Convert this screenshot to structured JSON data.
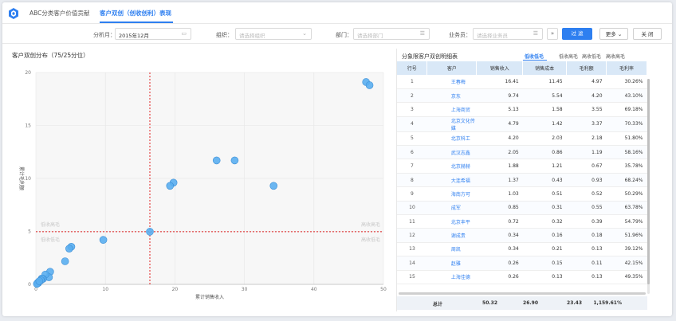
{
  "header": {
    "tabs": [
      {
        "label": "ABC分类客户价值贡献"
      },
      {
        "label": "客户双创（创收创利）表现"
      }
    ]
  },
  "filters": {
    "period_label": "分析月：",
    "period_value": "2015年12月",
    "org_label": "组织：",
    "org_placeholder": "请选择组织",
    "dept_label": "部门：",
    "dept_placeholder": "请选择部门",
    "sales_label": "业务员：",
    "sales_placeholder": "请选择业务员",
    "filter_button": "过 滤",
    "more_button": "更多",
    "close_button": "关 闭"
  },
  "left_panel": {
    "title": "客户双创分布（75/25分位）"
  },
  "chart_data": {
    "type": "scatter",
    "xlabel": "累计销售收入",
    "ylabel": "累计毛利额",
    "xlim": [
      0,
      50
    ],
    "ylim": [
      0,
      20
    ],
    "xticks": [
      0,
      10,
      20,
      30,
      40,
      50
    ],
    "yticks": [
      0,
      5,
      10,
      15,
      20
    ],
    "ref_x": 16.4,
    "ref_y": 4.97,
    "grid": true,
    "quadrant_labels": {
      "top_left": "低收高毛",
      "top_right": "高收高毛",
      "bottom_left": "低收低毛",
      "bottom_right": "高收低毛"
    },
    "point_color": "#5aaef0",
    "ref_line_color": "#e02020",
    "points": [
      {
        "x": 47.5,
        "y": 19.1
      },
      {
        "x": 48.0,
        "y": 18.8
      },
      {
        "x": 26.0,
        "y": 11.7
      },
      {
        "x": 28.6,
        "y": 11.7
      },
      {
        "x": 19.8,
        "y": 9.6
      },
      {
        "x": 19.3,
        "y": 9.3
      },
      {
        "x": 34.2,
        "y": 9.3
      },
      {
        "x": 16.4,
        "y": 4.97
      },
      {
        "x": 9.7,
        "y": 4.2
      },
      {
        "x": 5.1,
        "y": 3.55
      },
      {
        "x": 4.8,
        "y": 3.37
      },
      {
        "x": 4.2,
        "y": 2.18
      },
      {
        "x": 2.05,
        "y": 1.19
      },
      {
        "x": 1.88,
        "y": 0.67
      },
      {
        "x": 1.37,
        "y": 0.93
      },
      {
        "x": 1.03,
        "y": 0.52
      },
      {
        "x": 0.85,
        "y": 0.55
      },
      {
        "x": 0.72,
        "y": 0.39
      },
      {
        "x": 0.34,
        "y": 0.18
      },
      {
        "x": 0.34,
        "y": 0.13
      },
      {
        "x": 0.26,
        "y": 0.11
      },
      {
        "x": 0.26,
        "y": 0.13
      },
      {
        "x": 0.15,
        "y": 0.05
      },
      {
        "x": 0.5,
        "y": 0.3
      }
    ]
  },
  "right_panel": {
    "title": "分象限客户双创明细表",
    "tabs": [
      "低收低毛",
      "低收高毛",
      "高收低毛",
      "高收高毛"
    ],
    "active_tab": 0,
    "columns": [
      "行号",
      "客户",
      "销售收入",
      "销售成本",
      "毛利额",
      "毛利率"
    ],
    "rows": [
      [
        "1",
        "王春梅",
        "16.41",
        "11.45",
        "4.97",
        "30.26%"
      ],
      [
        "2",
        "京东",
        "9.74",
        "5.54",
        "4.20",
        "43.10%"
      ],
      [
        "3",
        "上海商贸",
        "5.13",
        "1.58",
        "3.55",
        "69.18%"
      ],
      [
        "4",
        "北京文化传媒",
        "4.79",
        "1.42",
        "3.37",
        "70.33%"
      ],
      [
        "5",
        "北京科工",
        "4.20",
        "2.03",
        "2.18",
        "51.80%"
      ],
      [
        "6",
        "武汉志鑫",
        "2.05",
        "0.86",
        "1.19",
        "58.16%"
      ],
      [
        "7",
        "北京赫赫",
        "1.88",
        "1.21",
        "0.67",
        "35.78%"
      ],
      [
        "8",
        "大连希福",
        "1.37",
        "0.43",
        "0.93",
        "68.24%"
      ],
      [
        "9",
        "海南方可",
        "1.03",
        "0.51",
        "0.52",
        "50.29%"
      ],
      [
        "10",
        "成军",
        "0.85",
        "0.31",
        "0.55",
        "63.78%"
      ],
      [
        "11",
        "北京丰平",
        "0.72",
        "0.32",
        "0.39",
        "54.79%"
      ],
      [
        "12",
        "谢成贵",
        "0.34",
        "0.16",
        "0.18",
        "51.96%"
      ],
      [
        "13",
        "周凯",
        "0.34",
        "0.21",
        "0.13",
        "39.12%"
      ],
      [
        "14",
        "赵雅",
        "0.26",
        "0.15",
        "0.11",
        "42.15%"
      ],
      [
        "15",
        "上海佳德",
        "0.26",
        "0.13",
        "0.13",
        "49.35%"
      ]
    ],
    "totals": {
      "label": "总计",
      "revenue": "50.32",
      "cost": "26.90",
      "profit": "23.43",
      "margin": "1,159.61%"
    }
  }
}
